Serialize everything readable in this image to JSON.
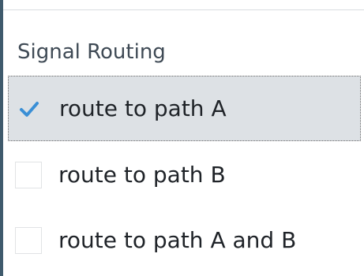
{
  "section": {
    "title": "Signal Routing"
  },
  "options": [
    {
      "label": "route to path A",
      "selected": true,
      "icon": "checkmark-icon"
    },
    {
      "label": "route to path B",
      "selected": false,
      "icon": "checkbox-icon"
    },
    {
      "label": "route to path A and B",
      "selected": false,
      "icon": "checkbox-icon"
    }
  ],
  "colors": {
    "accent": "#3a8fd6",
    "selected_bg": "#dde1e5",
    "left_rule": "#3f5a6c",
    "heading_text": "#3f4a55"
  }
}
